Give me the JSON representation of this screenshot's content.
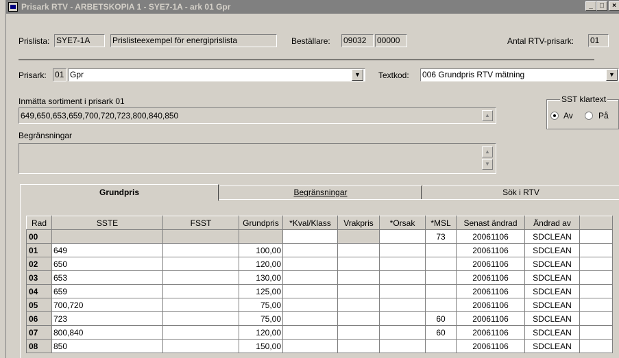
{
  "window": {
    "title": "Prisark RTV - ARBETSKOPIA 1 - SYE7-1A - ark 01 Gpr",
    "minimize": "_",
    "maximize": "□",
    "close": "×"
  },
  "header": {
    "prislista_label": "Prislista:",
    "prislista_code": "SYE7-1A",
    "prislista_name": "Prislisteexempel för energiprislista",
    "bestallare_label": "Beställare:",
    "bestallare_1": "09032",
    "bestallare_2": "00000",
    "antal_label": "Antal RTV-prisark:",
    "antal_value": "01"
  },
  "prisark": {
    "label": "Prisark:",
    "number": "01",
    "name": "Gpr",
    "textkod_label": "Textkod:",
    "textkod_value": "006 Grundpris RTV mätning"
  },
  "sortiment": {
    "label": "Inmätta sortiment i prisark 01",
    "value": "649,650,653,659,700,720,723,800,840,850"
  },
  "begransningar": {
    "label": "Begränsningar",
    "value": ""
  },
  "sst_klartext": {
    "label": "SST klartext",
    "option_av": "Av",
    "option_pa": "På",
    "selected": "Av"
  },
  "tabs": [
    {
      "label": "Grundpris",
      "active": true
    },
    {
      "label": "Begränsningar",
      "active": false
    },
    {
      "label": "Sök i RTV",
      "active": false
    }
  ],
  "grid": {
    "columns": [
      "Rad",
      "SSTE",
      "FSST",
      "Grundpris",
      "*Kval/Klass",
      "Vrakpris",
      "*Orsak",
      "*MSL",
      "Senast ändrad",
      "Ändrad av",
      ""
    ],
    "rows": [
      {
        "rad": "00",
        "sste": "",
        "fsst": "",
        "grundpris": "",
        "kval": "",
        "vrakpris": "",
        "orsak": "",
        "msl": "73",
        "senast": "20061106",
        "andrad": "SDCLEAN"
      },
      {
        "rad": "01",
        "sste": "649",
        "fsst": "",
        "grundpris": "100,00",
        "kval": "",
        "vrakpris": "",
        "orsak": "",
        "msl": "",
        "senast": "20061106",
        "andrad": "SDCLEAN"
      },
      {
        "rad": "02",
        "sste": "650",
        "fsst": "",
        "grundpris": "120,00",
        "kval": "",
        "vrakpris": "",
        "orsak": "",
        "msl": "",
        "senast": "20061106",
        "andrad": "SDCLEAN"
      },
      {
        "rad": "03",
        "sste": "653",
        "fsst": "",
        "grundpris": "130,00",
        "kval": "",
        "vrakpris": "",
        "orsak": "",
        "msl": "",
        "senast": "20061106",
        "andrad": "SDCLEAN"
      },
      {
        "rad": "04",
        "sste": "659",
        "fsst": "",
        "grundpris": "125,00",
        "kval": "",
        "vrakpris": "",
        "orsak": "",
        "msl": "",
        "senast": "20061106",
        "andrad": "SDCLEAN"
      },
      {
        "rad": "05",
        "sste": "700,720",
        "fsst": "",
        "grundpris": "75,00",
        "kval": "",
        "vrakpris": "",
        "orsak": "",
        "msl": "",
        "senast": "20061106",
        "andrad": "SDCLEAN"
      },
      {
        "rad": "06",
        "sste": "723",
        "fsst": "",
        "grundpris": "75,00",
        "kval": "",
        "vrakpris": "",
        "orsak": "",
        "msl": "60",
        "senast": "20061106",
        "andrad": "SDCLEAN"
      },
      {
        "rad": "07",
        "sste": "800,840",
        "fsst": "",
        "grundpris": "120,00",
        "kval": "",
        "vrakpris": "",
        "orsak": "",
        "msl": "60",
        "senast": "20061106",
        "andrad": "SDCLEAN"
      },
      {
        "rad": "08",
        "sste": "850",
        "fsst": "",
        "grundpris": "150,00",
        "kval": "",
        "vrakpris": "",
        "orsak": "",
        "msl": "",
        "senast": "20061106",
        "andrad": "SDCLEAN"
      }
    ]
  }
}
